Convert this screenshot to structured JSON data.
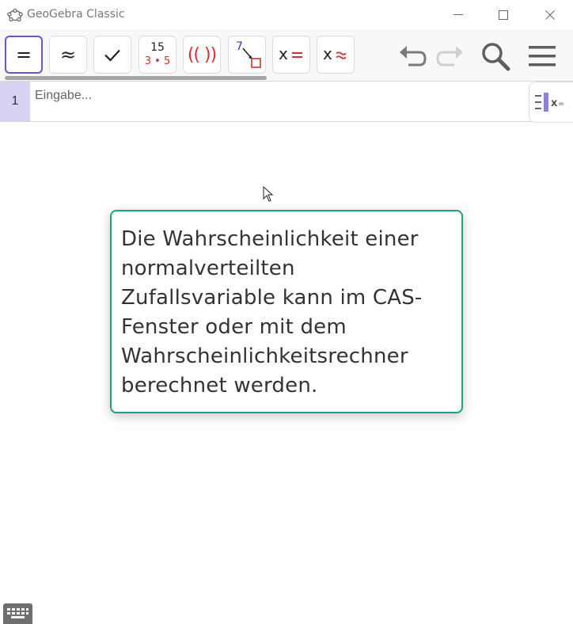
{
  "window": {
    "title": "GeoGebra Classic",
    "minimize": "minimize",
    "maximize": "maximize",
    "close": "close"
  },
  "toolbar": {
    "tools": [
      {
        "id": "exact",
        "glyph": "="
      },
      {
        "id": "numeric",
        "glyph": "≈"
      },
      {
        "id": "check",
        "glyph": "✓"
      },
      {
        "id": "factor",
        "top": "15",
        "bottom": "3 • 5"
      },
      {
        "id": "expand",
        "glyph": "(( ))"
      },
      {
        "id": "substitute",
        "glyph": "7"
      },
      {
        "id": "solve",
        "glyph": "x ="
      },
      {
        "id": "solve-numeric",
        "glyph": "x ≈"
      }
    ],
    "accent": "#6557d2",
    "red": "#d32f2f"
  },
  "algebra": {
    "row_number": "1",
    "input_placeholder": "Eingabe..."
  },
  "info_card": {
    "text": "Die Wahrscheinlichkeit einer normalverteilten Zufallsvariable kann im CAS-Fenster oder mit dem Wahrscheinlichkeitsrechner berechnet werden.",
    "border_color": "#1fa086"
  }
}
